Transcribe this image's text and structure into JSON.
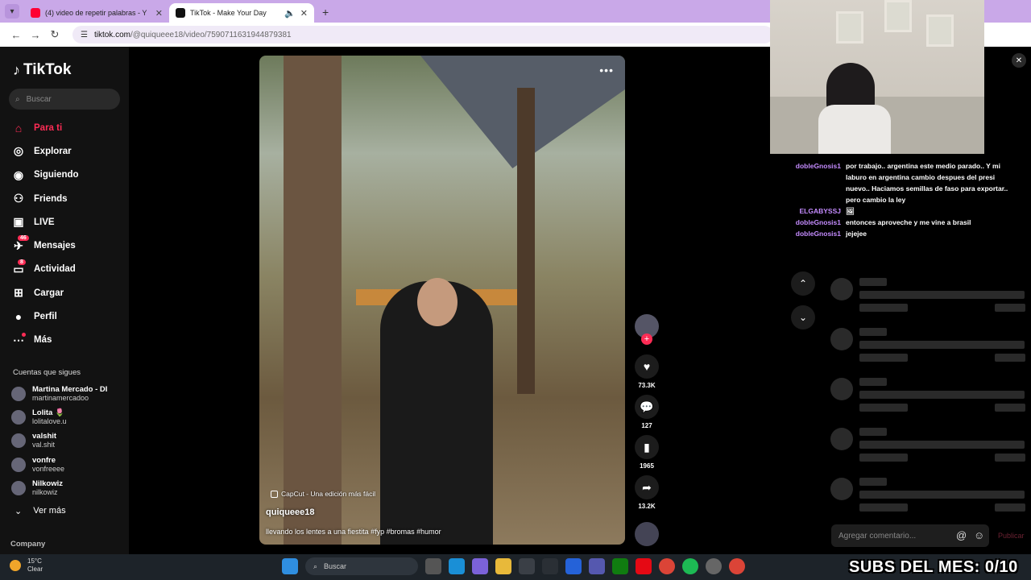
{
  "browser": {
    "tabs": [
      {
        "title": "(4) video de repetir palabras - Y",
        "favicon_color": "#ff0033",
        "active": false
      },
      {
        "title": "TikTok - Make Your Day",
        "favicon_color": "#111111",
        "active": true
      }
    ],
    "url_host": "tiktok.com",
    "url_path": "/@quiqueee18/video/7590711631944879381"
  },
  "tiktok": {
    "logo": "TikTok",
    "search_placeholder": "Buscar",
    "menu": [
      {
        "label": "Para ti",
        "icon": "home-icon",
        "glyph": "⌂",
        "active": true
      },
      {
        "label": "Explorar",
        "icon": "compass-icon",
        "glyph": "◎"
      },
      {
        "label": "Siguiendo",
        "icon": "following-icon",
        "glyph": "◉"
      },
      {
        "label": "Friends",
        "icon": "friends-icon",
        "glyph": "⚇"
      },
      {
        "label": "LIVE",
        "icon": "live-icon",
        "glyph": "▣"
      },
      {
        "label": "Mensajes",
        "icon": "messages-icon",
        "glyph": "✈",
        "badge": "46"
      },
      {
        "label": "Actividad",
        "icon": "activity-icon",
        "glyph": "▭",
        "badge": "8"
      },
      {
        "label": "Cargar",
        "icon": "upload-icon",
        "glyph": "⊞"
      },
      {
        "label": "Perfil",
        "icon": "profile-icon",
        "glyph": "●"
      },
      {
        "label": "Más",
        "icon": "more-icon",
        "glyph": "⋯",
        "dot": true
      }
    ],
    "following_header": "Cuentas que sigues",
    "following": [
      {
        "name": "Martina Mercado - DI",
        "handle": "martinamercadoo"
      },
      {
        "name": "Lolita 🌷",
        "handle": "lolitalove.u"
      },
      {
        "name": "valshit",
        "handle": "val.shit"
      },
      {
        "name": "vonfre",
        "handle": "vonfreeee"
      },
      {
        "name": "Nilkowiz",
        "handle": "nilkowiz"
      }
    ],
    "see_more": "Ver más",
    "company": "Company",
    "video": {
      "capcut": "CapCut - Una edición más fácil",
      "username": "quiqueee18",
      "caption": "llevando los lentes a una fiestita #fyp #bromas #humor"
    },
    "actions": {
      "likes": "73.3K",
      "comments": "127",
      "saves": "1965",
      "shares": "13.2K"
    },
    "comment_placeholder": "Agregar comentario...",
    "publish": "Publicar"
  },
  "chat": [
    {
      "user": "dobleGnosis1",
      "msg": "por trabajo.. argentina este medio parado.. Y mi laburo en argentina cambio despues del presi nuevo.. Haciamos semillas de faso para exportar.. pero cambio la ley"
    },
    {
      "user": "ELGABYSSJ",
      "msg": "🖼"
    },
    {
      "user": "dobleGnosis1",
      "msg": "entonces aproveche y me vine a brasil"
    },
    {
      "user": "dobleGnosis1",
      "msg": "jejejee"
    }
  ],
  "taskbar": {
    "temp": "15°C",
    "condition": "Clear",
    "search": "Buscar"
  },
  "overlay": {
    "subs_text": "SUBS DEL MES: 0/10"
  }
}
